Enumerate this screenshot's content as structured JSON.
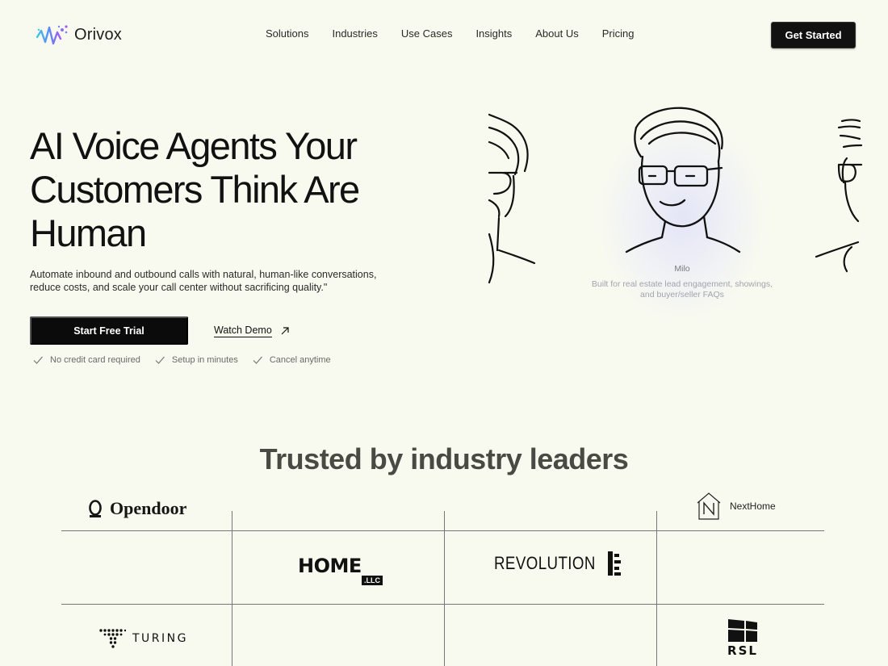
{
  "brand": {
    "name": "Orivox"
  },
  "nav": {
    "links": [
      "Solutions",
      "Industries",
      "Use Cases",
      "Insights",
      "About Us",
      "Pricing"
    ],
    "cta": "Get Started"
  },
  "hero": {
    "title": "AI Voice Agents Your Customers Think Are Human",
    "subtitle": "Automate inbound and outbound calls with natural, human-like conversations, reduce costs, and scale your call center without sacrificing quality.\"",
    "primary_cta": "Start Free Trial",
    "secondary_cta": "Watch Demo",
    "perks": [
      "No credit card required",
      "Setup in minutes",
      "Cancel anytime"
    ]
  },
  "agent": {
    "name": "Milo",
    "description": "Built for real estate lead engagement, showings, and buyer/seller FAQs"
  },
  "trusted": {
    "title": "Trusted by industry leaders",
    "logos": {
      "opendoor": "Opendoor",
      "nexthome": "NextHome",
      "home_llc": "HOME",
      "home_llc_suffix": ".LLC",
      "revolution": "REVOLUTION",
      "turing": "TURING",
      "rsl": "RSL"
    }
  },
  "colors": {
    "background": "#f9faef",
    "primary": "#0b0b0b",
    "muted_text": "#6a6a66",
    "brand_gradient": [
      "#5b8cf5",
      "#a259f7"
    ]
  }
}
